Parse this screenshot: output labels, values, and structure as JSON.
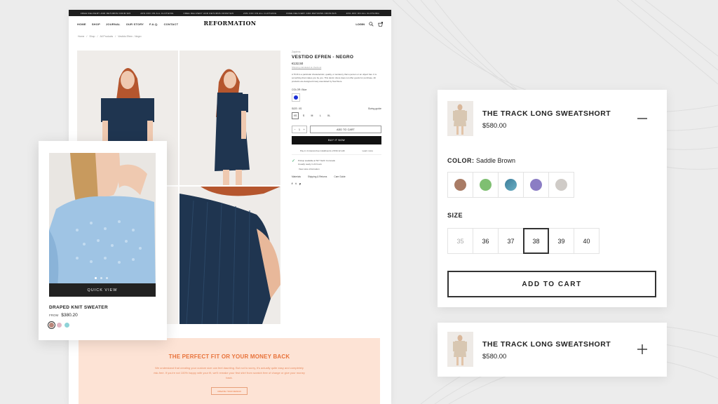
{
  "announcement": [
    "FREE DELIVERY AND RETURNS FROM $15",
    "20% OFF ON ALL CLOTHING",
    "FREE DELIVERY AND RETURNS FROM $15",
    "20% OFF ON ALL CLOTHING",
    "FREE DELIVERY AND RETURNS FROM $15",
    "20% OFF ON ALL CLOTHING"
  ],
  "nav": {
    "links": [
      "HOME",
      "SHOP",
      "JOURNAL",
      "OUR STORY",
      "F.A.Q.",
      "CONTACT"
    ],
    "logo": "REFORMATION",
    "login": "LOGIN"
  },
  "breadcrumb": [
    "Home",
    "/",
    "Shop",
    "/",
    "All Products",
    "/",
    "Vestido Efren - Negro"
  ],
  "product": {
    "brand": "Zapiens",
    "title": "VESTIDO EFREN - NEGRO",
    "price": "€132,50",
    "tax_note": "Shipping calculated at checkout",
    "description": "A Thrift is a particular characteristic, quality, or tendency that a person or an object has. It is something that makes you be you. This denim dress does not offer goods for purchase. All products are designed timely anecdoted by Teal Store",
    "color_label": "COLOR: Blue",
    "size_label": "SIZE: XS",
    "size_guide": "Sizing guide",
    "sizes": [
      "XS",
      "S",
      "M",
      "L",
      "XL"
    ],
    "qty": "1",
    "add_to_cart": "ADD TO CART",
    "buy_now": "BUY IT NOW",
    "installments": "Pay in 4 interest-free installments of €33,12 with",
    "learn_more": "Learn more",
    "pickup": "Pickup available at 527 North Coronado",
    "pickup_time": "Usually ready in 24 hours",
    "store_info": "View store information",
    "tabs": [
      "Materials",
      "Shipping & Returns",
      "Care Guide"
    ],
    "social": [
      "f",
      "t",
      "p"
    ]
  },
  "promo": {
    "heading": "THE PERFECT FIT OR YOUR MONEY BACK",
    "text": "We understand that creating your custom size can feel daunting. But not to worry, it's actually quite easy and completely risk-free. If you're not 100% happy with your fit, we'll remake your first shirt from scratch free of charge or give your money back.",
    "button": "CREATE YOUR DESIGN"
  },
  "quick_view": {
    "button": "QUICK VIEW",
    "name": "DRAPED KNIT SWEATER",
    "from": "FROM",
    "price": "$380.20",
    "swatches": [
      "#b9867a",
      "#e2b6c4",
      "#8fd3d8"
    ]
  },
  "variant_card": {
    "title": "THE TRACK LONG SWEATSHORT",
    "price": "$580.00",
    "color_label": "COLOR:",
    "color_value": "Saddle Brown",
    "colors": [
      "#a97c66",
      "#7fbf72",
      "#4a8fa8",
      "#8b7dc4",
      "#cfcbc7"
    ],
    "size_label": "SIZE",
    "sizes": [
      "35",
      "36",
      "37",
      "38",
      "39",
      "40"
    ],
    "selected_size": "38",
    "add_to_cart": "ADD TO CART"
  },
  "collapsed_card": {
    "title": "THE TRACK LONG SWEATSHORT",
    "price": "$580.00"
  }
}
